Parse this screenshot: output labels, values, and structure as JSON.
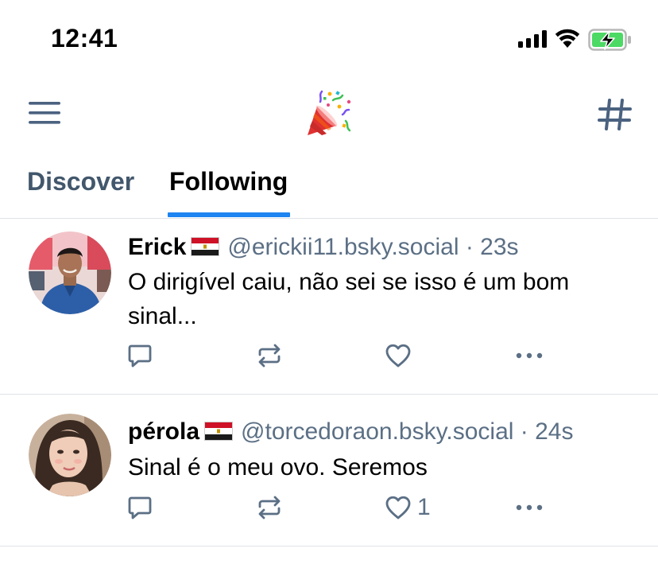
{
  "status_bar": {
    "time": "12:41",
    "icons": [
      "cellular-signal-icon",
      "wifi-icon",
      "battery-charging-icon"
    ]
  },
  "header": {
    "menu_icon": "hamburger-menu-icon",
    "logo_icon": "party-popper-icon",
    "feeds_icon": "hashtag-icon"
  },
  "tabs": [
    {
      "label": "Discover",
      "active": false
    },
    {
      "label": "Following",
      "active": true
    }
  ],
  "colors": {
    "accent": "#1d84f1",
    "muted_text": "#5b6f85",
    "tab_inactive": "#42576c",
    "divider": "#dfe3e8",
    "icon": "#4b6280"
  },
  "posts": [
    {
      "author_name": "Erick",
      "author_flag": "flag-egypt-icon",
      "handle": "@erickii11.bsky.social",
      "time": "· 23s",
      "text": "O dirigível caiu, não sei se isso é um bom sinal...",
      "like_count": "",
      "actions": [
        "reply-icon",
        "repost-icon",
        "like-heart-icon",
        "more-options-icon"
      ]
    },
    {
      "author_name": "pérola",
      "author_flag": "flag-egypt-icon",
      "handle": "@torcedoraon.bsky.social",
      "time": "· 24s",
      "text": "Sinal é o meu ovo. Seremos",
      "like_count": "1",
      "actions": [
        "reply-icon",
        "repost-icon",
        "like-heart-icon",
        "more-options-icon"
      ]
    }
  ]
}
